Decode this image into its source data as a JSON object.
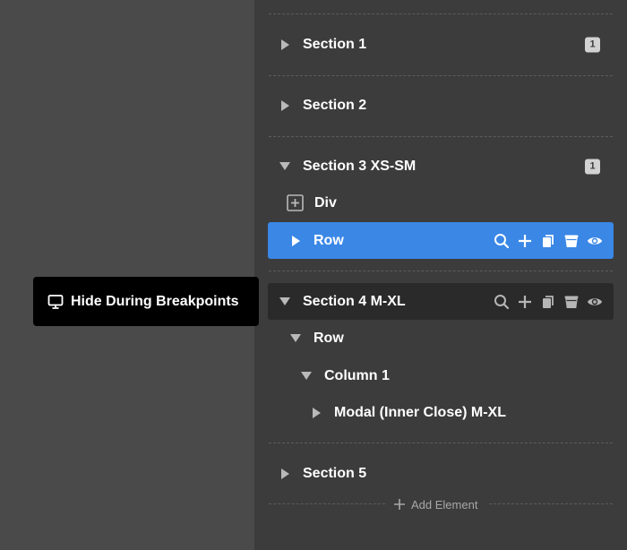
{
  "tree": {
    "items": [
      {
        "label": "Section 1",
        "badge": "1"
      },
      {
        "label": "Section 2"
      },
      {
        "label": "Section 3 XS-SM",
        "badge": "1"
      },
      {
        "label": "Div"
      },
      {
        "label": "Row"
      },
      {
        "label": "Section 4 M-XL"
      },
      {
        "label": "Row"
      },
      {
        "label": "Column 1"
      },
      {
        "label": "Modal (Inner Close) M-XL"
      },
      {
        "label": "Section 5"
      }
    ],
    "add_element_label": "Add Element"
  },
  "tooltip": {
    "text": "Hide During Breakpoints",
    "icon": "monitor-icon"
  },
  "colors": {
    "selected": "#3a87e6",
    "panel": "#3c3c3c",
    "canvas": "#4a4a4a",
    "tooltip": "#000000"
  }
}
